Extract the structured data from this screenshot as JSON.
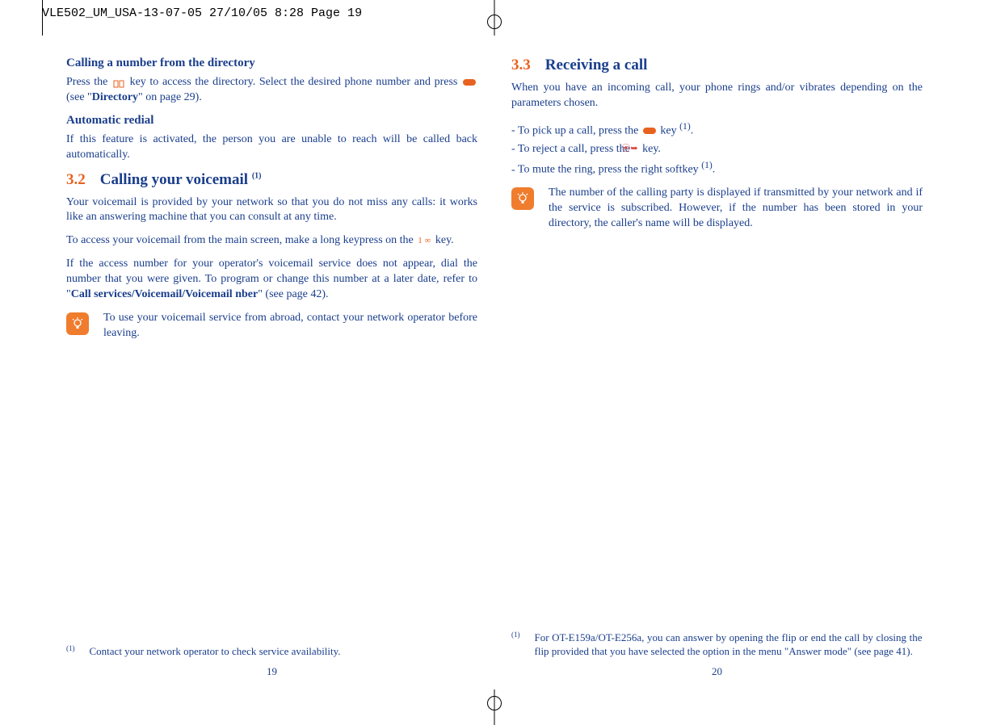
{
  "header": "VLE502_UM_USA-13-07-05  27/10/05  8:28  Page 19",
  "left": {
    "h1": "Calling a number from the directory",
    "p1a": "Press the ",
    "p1b": " key to access the directory. Select the desired phone number and press ",
    "p1c": " (see \"",
    "p1_bold": "Directory",
    "p1d": "\" on page 29).",
    "h2": "Automatic redial",
    "p2": "If this feature is activated, the person you are unable to reach will be called back automatically.",
    "sec_num": "3.2",
    "sec_title": "Calling your voicemail ",
    "sec_sup": "(1)",
    "p3": "Your voicemail is provided by your network so that you do not miss any calls: it works like an answering machine that you can consult at any time.",
    "p4a": "To access your voicemail from the main screen, make a long keypress on the ",
    "p4b": " key.",
    "p5a": "If the access number for your operator's voicemail service does not appear, dial the number that you were given. To program or change this number at a later date, refer to \"",
    "p5_bold": "Call services/Voicemail/Voicemail nber",
    "p5b": "\" (see page 42).",
    "note": "To use your voicemail service from abroad, contact your network operator before leaving.",
    "footnote": "Contact your network operator to check service availability.",
    "page_num": "19"
  },
  "right": {
    "sec_num": "3.3",
    "sec_title": "Receiving a call",
    "p1": "When you have an incoming call, your phone rings and/or vibrates depending on the parameters chosen.",
    "li1a": "To pick up a call, press the ",
    "li1b": " key ",
    "li1_sup": "(1)",
    "li1c": ".",
    "li2a": "To reject a call, press the ",
    "li2b": " key.",
    "li3a": "To mute the ring, press the right softkey ",
    "li3_sup": "(1)",
    "li3b": ".",
    "note": "The number of the calling party is displayed if transmitted by your network and if the service is subscribed. However, if the number has been stored in your directory, the caller's name will be displayed.",
    "footnote_a": "For OT-E159a/OT-E256a, you can answer by opening the flip or end the call by closing the flip provided that you have selected the option in the menu \"",
    "footnote_bold": "Answer mode",
    "footnote_b": "\" (see page 41).",
    "page_num": "20"
  }
}
